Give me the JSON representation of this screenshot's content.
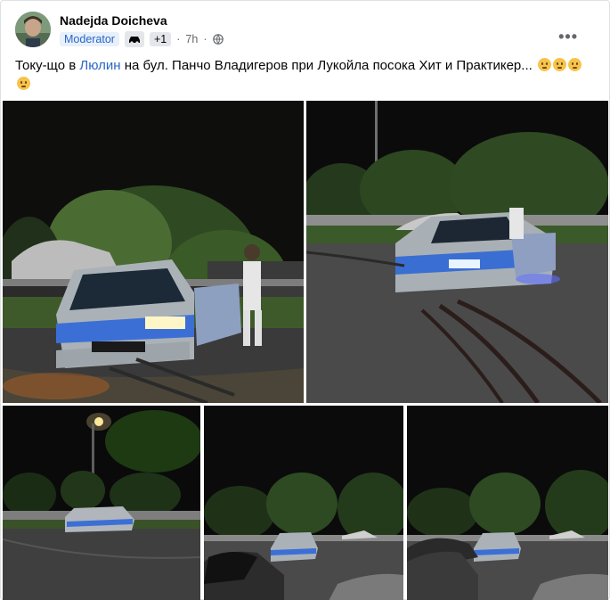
{
  "post": {
    "author": "Nadejda Doicheva",
    "badge_role": "Moderator",
    "badge_icon": "car-group-badge-icon",
    "badge_extra": "+1",
    "time": "7h",
    "privacy_icon": "globe-icon",
    "more_icon": "more-options-icon",
    "more_label": "•••",
    "text_before": "Току-що в ",
    "text_link": "Люлин",
    "text_after": " на бул. Панчо Владигеров при Лукойла посока Хит и Практикер... ",
    "emoji_count": 4,
    "link_color": "#2a66c7"
  },
  "photos": [
    {
      "name": "crash-photo-1",
      "description_icon": "photo"
    },
    {
      "name": "crash-photo-2",
      "description_icon": "photo"
    },
    {
      "name": "crash-photo-3",
      "description_icon": "photo"
    },
    {
      "name": "crash-photo-4",
      "description_icon": "photo"
    },
    {
      "name": "crash-photo-5",
      "description_icon": "photo"
    }
  ]
}
